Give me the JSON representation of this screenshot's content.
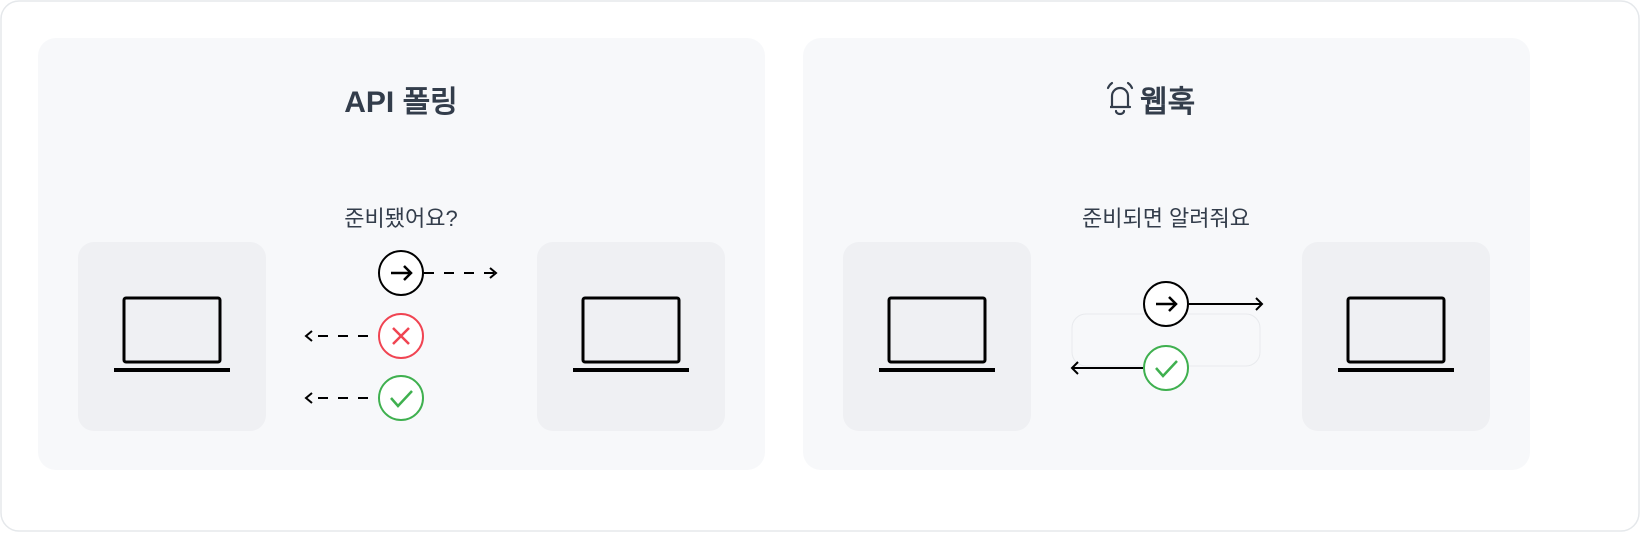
{
  "polling": {
    "title": "API 폴링",
    "message": "준비됐어요?"
  },
  "webhook": {
    "title": "웹훅",
    "message": "준비되면 알려줘요",
    "icon": "bell-icon"
  },
  "colors": {
    "panel": "#f7f8fa",
    "device": "#eff0f3",
    "text": "#333d4b",
    "error": "#f04452",
    "success": "#3fb04f"
  }
}
